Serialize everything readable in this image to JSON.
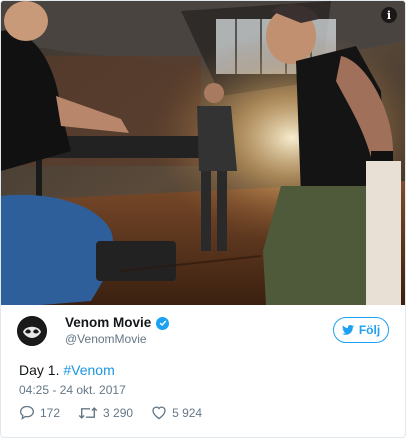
{
  "media": {
    "alt": "Tweet photo",
    "info_icon_glyph": "i"
  },
  "author": {
    "display_name": "Venom Movie",
    "handle": "@VenomMovie",
    "verified": true,
    "avatar_icon": "venom-avatar"
  },
  "follow": {
    "label": "Följ",
    "icon": "twitter-bird-icon"
  },
  "tweet": {
    "text": "Day 1. ",
    "hashtag": "#Venom",
    "timestamp": "04:25 - 24 okt. 2017"
  },
  "actions": {
    "replies": "172",
    "retweets": "3 290",
    "likes": "5 924"
  },
  "colors": {
    "accent": "#1da1f2",
    "link": "#1b95e0",
    "secondary_text": "#657786"
  }
}
